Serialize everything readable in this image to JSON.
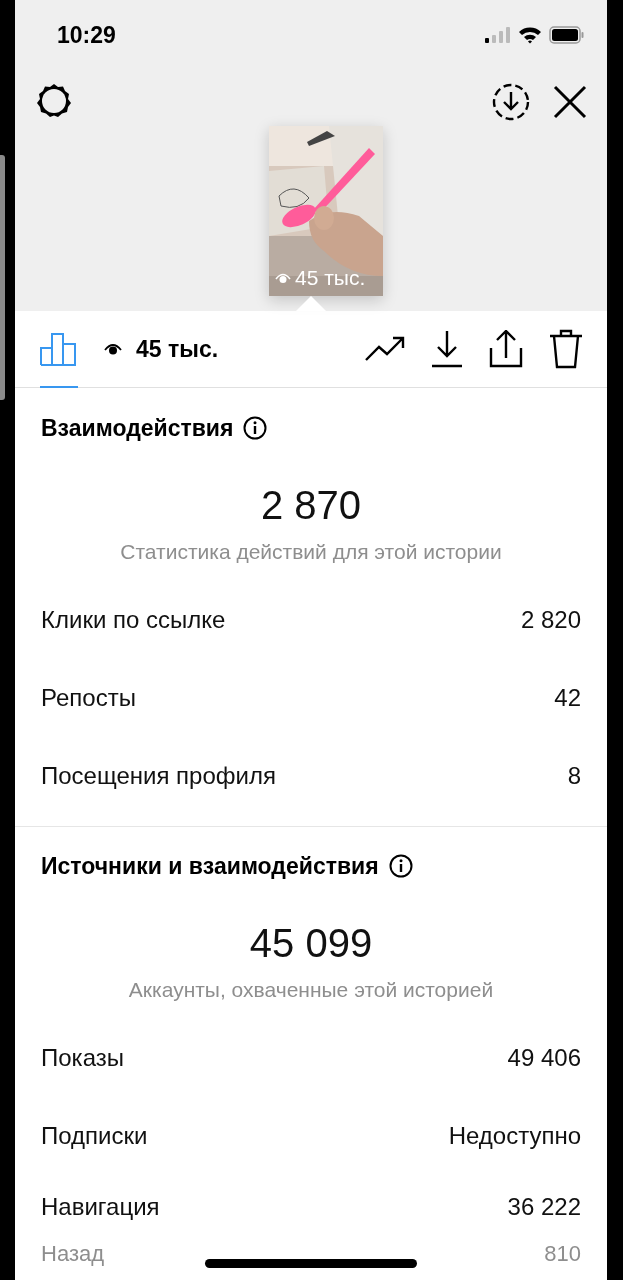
{
  "status_bar": {
    "time": "10:29"
  },
  "story": {
    "views": "45 тыс."
  },
  "toolbar": {
    "insights_tab": {
      "selected": true
    },
    "views": "45 тыс."
  },
  "sections": [
    {
      "title": "Взаимодействия",
      "total": "2 870",
      "caption": "Статистика действий для этой истории",
      "rows": [
        {
          "kind": "row",
          "label": "Клики по ссылке",
          "value": "2 820"
        },
        {
          "kind": "row",
          "label": "Репосты",
          "value": "42"
        },
        {
          "kind": "row",
          "label": "Посещения профиля",
          "value": "8"
        }
      ]
    },
    {
      "title": "Источники и взаимодействия",
      "total": "45 099",
      "caption": "Аккаунты, охваченные этой историей",
      "rows": [
        {
          "kind": "row",
          "label": "Показы",
          "value": "49 406"
        },
        {
          "kind": "row",
          "label": "Подписки",
          "value": "Недоступно"
        },
        {
          "kind": "group",
          "label": "Навигация",
          "value": "36 222"
        },
        {
          "kind": "sub",
          "label": "Назад",
          "value": "810"
        }
      ]
    }
  ]
}
